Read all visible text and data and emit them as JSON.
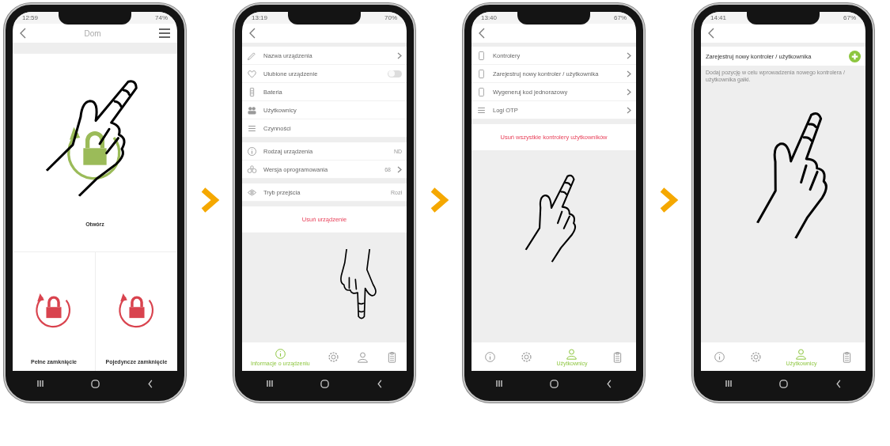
{
  "phones": [
    {
      "kind": "lock",
      "status": {
        "time": "12:59",
        "battery": "74%"
      },
      "title": "Dom",
      "main_action": {
        "label": "Otwórz",
        "color": "#9bbb59"
      },
      "actions": [
        {
          "label": "Pełne zamknięcie",
          "color": "#d9434e"
        },
        {
          "label": "Pojedyncze zamknięcie",
          "color": "#d9434e"
        }
      ]
    },
    {
      "kind": "list",
      "status": {
        "time": "13:19",
        "battery": "70%"
      },
      "sections": [
        {
          "rows": [
            {
              "kind": "name",
              "label": "Nazwa urządzenia"
            },
            {
              "kind": "favorite",
              "label": "Ulubione urządzenie",
              "on": false
            },
            {
              "kind": "battery",
              "label": "Bateria"
            },
            {
              "kind": "users",
              "label": "Użytkownicy"
            },
            {
              "kind": "actions",
              "label": "Czynności"
            }
          ]
        },
        {
          "rows": [
            {
              "kind": "type",
              "label": "Rodzaj urządzenia",
              "value": "ND"
            },
            {
              "kind": "firmware",
              "label": "Wersja oprogramowania",
              "value": "68"
            }
          ]
        },
        {
          "rows": [
            {
              "kind": "mode",
              "label": "Tryb przejścia",
              "value": "Rozł"
            }
          ]
        }
      ],
      "danger_action": "Usuń urządzenie",
      "tabs": [
        {
          "kind": "info",
          "label": "Informacje o urządzeniu",
          "selected": true
        },
        {
          "kind": "settings",
          "selected": false
        },
        {
          "kind": "users",
          "selected": false
        },
        {
          "kind": "log",
          "selected": false
        }
      ]
    },
    {
      "kind": "list",
      "status": {
        "time": "13:40",
        "battery": "67%"
      },
      "sections": [
        {
          "rows": [
            {
              "kind": "controllers",
              "label": "Kontrolery"
            },
            {
              "kind": "register",
              "label": "Zarejestruj nowy kontroler / użytkownika"
            },
            {
              "kind": "code",
              "label": "Wygeneruj kod jednorazowy"
            },
            {
              "kind": "logs",
              "label": "Logi OTP"
            }
          ]
        }
      ],
      "danger_action": "Usuń wszystkie kontrolery użytkowników",
      "tabs": [
        {
          "kind": "info",
          "selected": false
        },
        {
          "kind": "settings",
          "selected": false
        },
        {
          "kind": "users",
          "label": "Użytkownicy",
          "selected": true
        },
        {
          "kind": "log",
          "selected": false
        }
      ]
    },
    {
      "kind": "register",
      "status": {
        "time": "14:41",
        "battery": "67%"
      },
      "register_row": {
        "label": "Zarejestruj nowy kontroler / użytkownika"
      },
      "description": "Dodaj pozycję w celu wprowadzenia nowego kontrolera / użytkownika gałki.",
      "tabs": [
        {
          "kind": "info",
          "selected": false
        },
        {
          "kind": "settings",
          "selected": false
        },
        {
          "kind": "users",
          "label": "Użytkownicy",
          "selected": true
        },
        {
          "kind": "log",
          "selected": false
        }
      ]
    }
  ]
}
